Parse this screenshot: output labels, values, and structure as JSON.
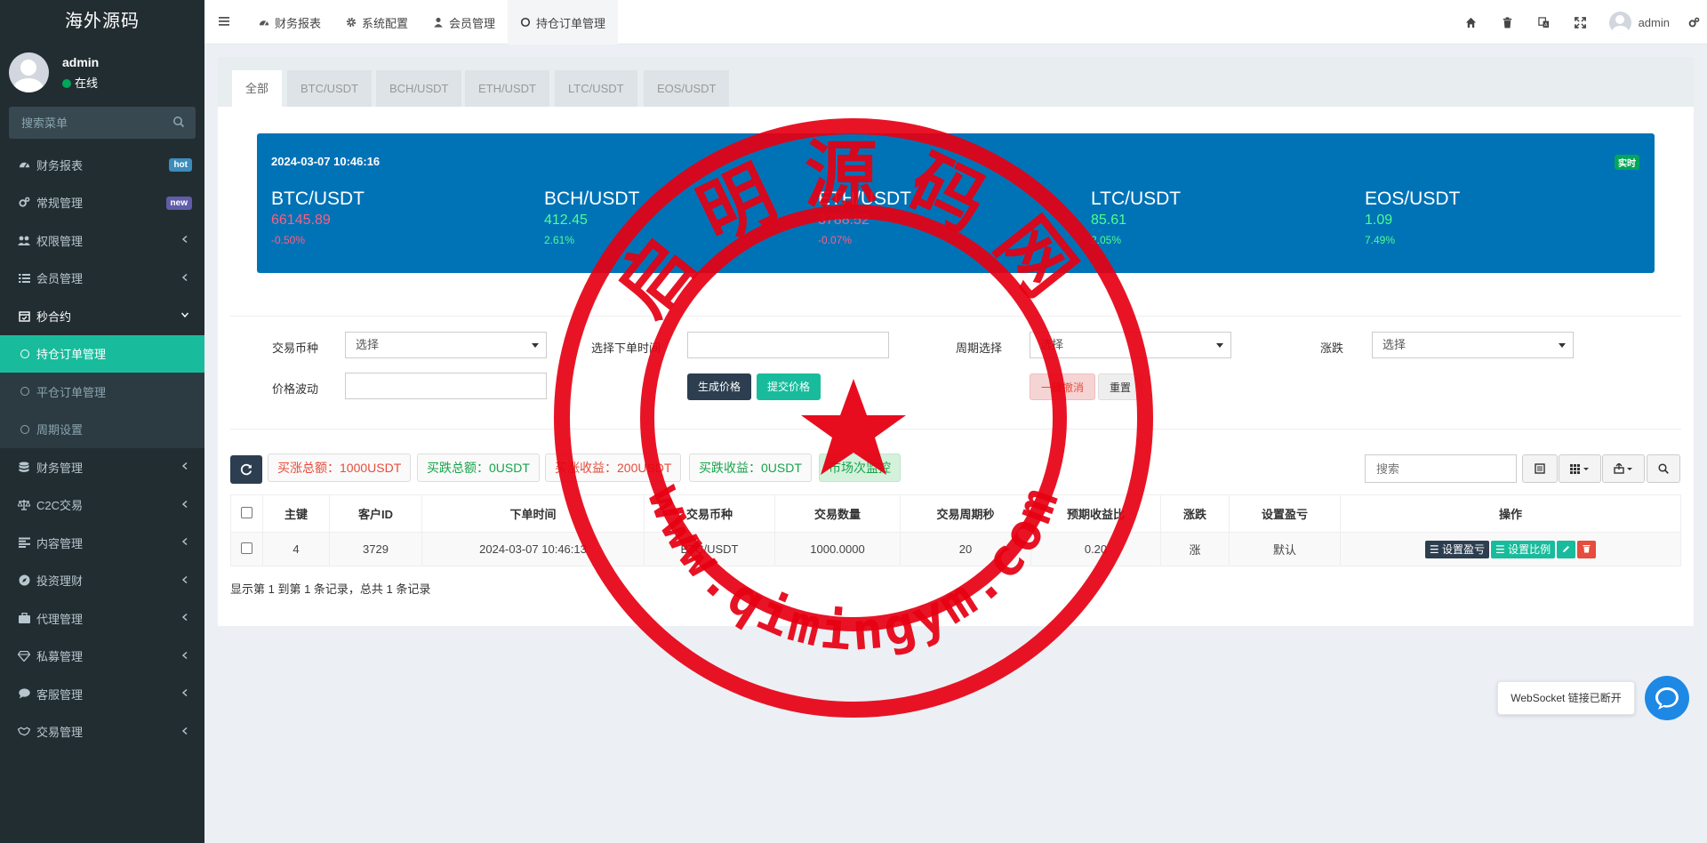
{
  "sidebar": {
    "logo": "海外源码",
    "user_name": "admin",
    "user_status": "在线",
    "search_placeholder": "搜索菜单",
    "items": [
      {
        "label": "财务报表",
        "icon": "dashboard-icon",
        "badge": "hot",
        "badge_color": "#3c8dbc"
      },
      {
        "label": "常规管理",
        "icon": "cogs-icon",
        "badge": "new",
        "badge_color": "#605ca8"
      },
      {
        "label": "权限管理",
        "icon": "group-icon"
      },
      {
        "label": "会员管理",
        "icon": "list-icon"
      },
      {
        "label": "秒合约",
        "icon": "calendar-check-icon",
        "open": true
      }
    ],
    "sub_items": [
      {
        "label": "持仓订单管理",
        "active": true
      },
      {
        "label": "平仓订单管理"
      },
      {
        "label": "周期设置"
      }
    ],
    "items_after": [
      {
        "label": "财务管理",
        "icon": "database-icon"
      },
      {
        "label": "C2C交易",
        "icon": "balance-scale-icon"
      },
      {
        "label": "内容管理",
        "icon": "align-left-icon"
      },
      {
        "label": "投资理财",
        "icon": "compass-icon"
      },
      {
        "label": "代理管理",
        "icon": "briefcase-icon"
      },
      {
        "label": "私募管理",
        "icon": "diamond-icon"
      },
      {
        "label": "客服管理",
        "icon": "comment-icon"
      },
      {
        "label": "交易管理",
        "icon": "handshake-icon"
      }
    ]
  },
  "header": {
    "tabs": [
      {
        "label": "财务报表",
        "icon": "dashboard-icon"
      },
      {
        "label": "系统配置",
        "icon": "gear-icon"
      },
      {
        "label": "会员管理",
        "icon": "user-icon"
      },
      {
        "label": "持仓订单管理",
        "icon": "circle-icon",
        "active": true
      }
    ],
    "user_name": "admin"
  },
  "page_tabs": [
    "全部",
    "BTC/USDT",
    "BCH/USDT",
    "ETH/USDT",
    "LTC/USDT",
    "EOS/USDT"
  ],
  "ticker": {
    "datetime": "2024-03-07 10:46:16",
    "badge": "实时",
    "coins": [
      {
        "symbol": "BTC/USDT",
        "price": "66145.89",
        "change": "-0.50%",
        "dir": "down"
      },
      {
        "symbol": "BCH/USDT",
        "price": "412.45",
        "change": "2.61%",
        "dir": "up"
      },
      {
        "symbol": "ETH/USDT",
        "price": "3788.52",
        "change": "-0.07%",
        "dir": "down"
      },
      {
        "symbol": "LTC/USDT",
        "price": "85.61",
        "change": "2.05%",
        "dir": "up"
      },
      {
        "symbol": "EOS/USDT",
        "price": "1.09",
        "change": "7.49%",
        "dir": "up"
      }
    ]
  },
  "filters": {
    "coin_label": "交易币种",
    "coin_value": "选择",
    "time_label": "选择下单时间",
    "period_label": "周期选择",
    "period_value": "选择",
    "updown_label": "涨跌",
    "updown_value": "选择",
    "volatility_label": "价格波动",
    "generate_btn": "生成价格",
    "submit_btn": "提交价格",
    "cancel_btn": "一键撤消",
    "reset_btn": "重置"
  },
  "stats": {
    "buy_up_total": "买涨总额：1000USDT",
    "buy_down_total": "买跌总额：0USDT",
    "buy_up_profit": "买涨收益：200USDT",
    "buy_down_profit": "买跌收益：0USDT",
    "monitor": "市场次监控",
    "search_placeholder": "搜索"
  },
  "table": {
    "headers": [
      "主键",
      "客户ID",
      "下单时间",
      "交易币种",
      "交易数量",
      "交易周期秒",
      "预期收益比",
      "涨跌",
      "设置盈亏",
      "操作"
    ],
    "rows": [
      [
        "4",
        "3729",
        "2024-03-07 10:46:13",
        "BTC/USDT",
        "1000.0000",
        "20",
        "0.20",
        "涨",
        "默认"
      ]
    ],
    "op_set_pl": "设置盈亏",
    "op_set_ratio": "设置比例"
  },
  "footer_text": "显示第 1 到第 1 条记录，总共 1 条记录",
  "ws_popup": "WebSocket 链接已断开",
  "watermark": {
    "top_text": "启明源码网",
    "bottom_text": "www.qimingym.com"
  },
  "colors": {
    "sidebar_bg": "#222d32",
    "active_green": "#18bc9c",
    "ticker_blue": "#0073b7",
    "stamp_red": "#e60012"
  }
}
